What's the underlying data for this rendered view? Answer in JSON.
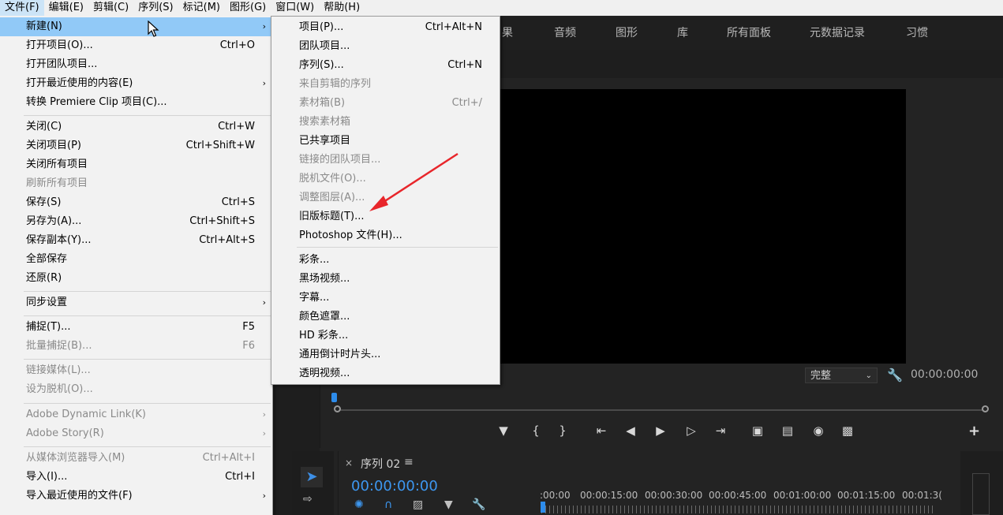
{
  "menubar": {
    "items": [
      "文件(F)",
      "编辑(E)",
      "剪辑(C)",
      "序列(S)",
      "标记(M)",
      "图形(G)",
      "窗口(W)",
      "帮助(H)"
    ]
  },
  "workspace_tabs": [
    "果",
    "音频",
    "图形",
    "库",
    "所有面板",
    "元数据记录",
    "习惯"
  ],
  "monitor": {
    "fit_value": "完整",
    "timecode": "00:00:00:00"
  },
  "timeline": {
    "sequence_name": "序列 02",
    "timecode": "00:00:00:00",
    "ruler_labels": [
      ":00:00",
      "00:00:15:00",
      "00:00:30:00",
      "00:00:45:00",
      "00:01:00:00",
      "00:01:15:00",
      "00:01:3("
    ]
  },
  "file_menu": {
    "items": [
      {
        "label": "新建(N)",
        "shortcut": "",
        "submenu": true,
        "disabled": false,
        "highlight": true
      },
      {
        "label": "打开项目(O)...",
        "shortcut": "Ctrl+O",
        "submenu": false,
        "disabled": false
      },
      {
        "label": "打开团队项目...",
        "shortcut": "",
        "submenu": false,
        "disabled": false
      },
      {
        "label": "打开最近使用的内容(E)",
        "shortcut": "",
        "submenu": true,
        "disabled": false
      },
      {
        "label": "转换 Premiere Clip 项目(C)...",
        "shortcut": "",
        "submenu": false,
        "disabled": false
      },
      {
        "label": "关闭(C)",
        "shortcut": "Ctrl+W",
        "submenu": false,
        "disabled": false
      },
      {
        "label": "关闭项目(P)",
        "shortcut": "Ctrl+Shift+W",
        "submenu": false,
        "disabled": false
      },
      {
        "label": "关闭所有项目",
        "shortcut": "",
        "submenu": false,
        "disabled": false
      },
      {
        "label": "刷新所有项目",
        "shortcut": "",
        "submenu": false,
        "disabled": true
      },
      {
        "label": "保存(S)",
        "shortcut": "Ctrl+S",
        "submenu": false,
        "disabled": false
      },
      {
        "label": "另存为(A)...",
        "shortcut": "Ctrl+Shift+S",
        "submenu": false,
        "disabled": false
      },
      {
        "label": "保存副本(Y)...",
        "shortcut": "Ctrl+Alt+S",
        "submenu": false,
        "disabled": false
      },
      {
        "label": "全部保存",
        "shortcut": "",
        "submenu": false,
        "disabled": false
      },
      {
        "label": "还原(R)",
        "shortcut": "",
        "submenu": false,
        "disabled": false
      },
      {
        "label": "同步设置",
        "shortcut": "",
        "submenu": true,
        "disabled": false
      },
      {
        "label": "捕捉(T)...",
        "shortcut": "F5",
        "submenu": false,
        "disabled": false
      },
      {
        "label": "批量捕捉(B)...",
        "shortcut": "F6",
        "submenu": false,
        "disabled": true
      },
      {
        "label": "链接媒体(L)...",
        "shortcut": "",
        "submenu": false,
        "disabled": true
      },
      {
        "label": "设为脱机(O)...",
        "shortcut": "",
        "submenu": false,
        "disabled": true
      },
      {
        "label": "Adobe Dynamic Link(K)",
        "shortcut": "",
        "submenu": true,
        "disabled": true
      },
      {
        "label": "Adobe Story(R)",
        "shortcut": "",
        "submenu": true,
        "disabled": true
      },
      {
        "label": "从媒体浏览器导入(M)",
        "shortcut": "Ctrl+Alt+I",
        "submenu": false,
        "disabled": true
      },
      {
        "label": "导入(I)...",
        "shortcut": "Ctrl+I",
        "submenu": false,
        "disabled": false
      },
      {
        "label": "导入最近使用的文件(F)",
        "shortcut": "",
        "submenu": true,
        "disabled": false
      }
    ]
  },
  "new_submenu": {
    "items": [
      {
        "label": "项目(P)...",
        "shortcut": "Ctrl+Alt+N",
        "disabled": false
      },
      {
        "label": "团队项目...",
        "shortcut": "",
        "disabled": false
      },
      {
        "label": "序列(S)...",
        "shortcut": "Ctrl+N",
        "disabled": false
      },
      {
        "label": "来自剪辑的序列",
        "shortcut": "",
        "disabled": true
      },
      {
        "label": "素材箱(B)",
        "shortcut": "Ctrl+/",
        "disabled": true
      },
      {
        "label": "搜索素材箱",
        "shortcut": "",
        "disabled": true
      },
      {
        "label": "已共享项目",
        "shortcut": "",
        "disabled": false
      },
      {
        "label": "链接的团队项目...",
        "shortcut": "",
        "disabled": true
      },
      {
        "label": "脱机文件(O)...",
        "shortcut": "",
        "disabled": true
      },
      {
        "label": "调整图层(A)...",
        "shortcut": "",
        "disabled": true
      },
      {
        "label": "旧版标题(T)...",
        "shortcut": "",
        "disabled": false
      },
      {
        "label": "Photoshop 文件(H)...",
        "shortcut": "",
        "disabled": false
      },
      {
        "label": "彩条...",
        "shortcut": "",
        "disabled": false
      },
      {
        "label": "黑场视频...",
        "shortcut": "",
        "disabled": false
      },
      {
        "label": "字幕...",
        "shortcut": "",
        "disabled": false
      },
      {
        "label": "颜色遮罩...",
        "shortcut": "",
        "disabled": false
      },
      {
        "label": "HD 彩条...",
        "shortcut": "",
        "disabled": false
      },
      {
        "label": "通用倒计时片头...",
        "shortcut": "",
        "disabled": false
      },
      {
        "label": "透明视频...",
        "shortcut": "",
        "disabled": false
      }
    ]
  },
  "colors": {
    "menu_bg": "#f2f2f2",
    "menu_highlight": "#91c9f7",
    "accent_blue": "#3d97f0",
    "annotation_arrow": "#e8262b"
  },
  "icons": {
    "cursor": "mouse-pointer-icon",
    "annotation": "red-arrow-annotation"
  }
}
